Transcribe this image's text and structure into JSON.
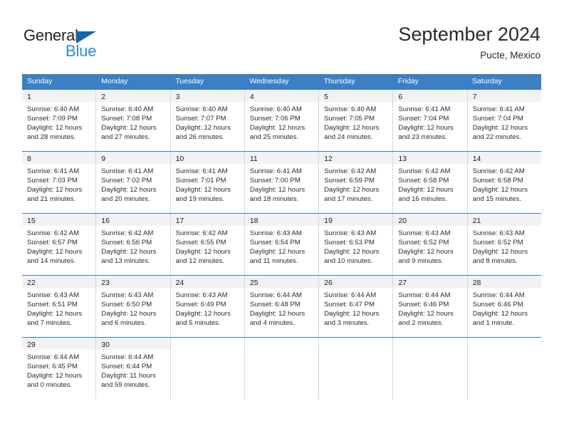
{
  "brand": {
    "name_part1": "General",
    "name_part2": "Blue",
    "triangle_color": "#1565a8",
    "blue_color": "#2e8bd4"
  },
  "header": {
    "title": "September 2024",
    "subtitle": "Pucte, Mexico"
  },
  "theme": {
    "header_blue": "#3b7fc4",
    "daynum_band": "#f2f2f2",
    "cell_border": "#d8d8d8"
  },
  "weekdays": [
    "Sunday",
    "Monday",
    "Tuesday",
    "Wednesday",
    "Thursday",
    "Friday",
    "Saturday"
  ],
  "weeks": [
    [
      {
        "day": "1",
        "sunrise": "Sunrise: 6:40 AM",
        "sunset": "Sunset: 7:09 PM",
        "daylight1": "Daylight: 12 hours",
        "daylight2": "and 28 minutes."
      },
      {
        "day": "2",
        "sunrise": "Sunrise: 6:40 AM",
        "sunset": "Sunset: 7:08 PM",
        "daylight1": "Daylight: 12 hours",
        "daylight2": "and 27 minutes."
      },
      {
        "day": "3",
        "sunrise": "Sunrise: 6:40 AM",
        "sunset": "Sunset: 7:07 PM",
        "daylight1": "Daylight: 12 hours",
        "daylight2": "and 26 minutes."
      },
      {
        "day": "4",
        "sunrise": "Sunrise: 6:40 AM",
        "sunset": "Sunset: 7:06 PM",
        "daylight1": "Daylight: 12 hours",
        "daylight2": "and 25 minutes."
      },
      {
        "day": "5",
        "sunrise": "Sunrise: 6:40 AM",
        "sunset": "Sunset: 7:05 PM",
        "daylight1": "Daylight: 12 hours",
        "daylight2": "and 24 minutes."
      },
      {
        "day": "6",
        "sunrise": "Sunrise: 6:41 AM",
        "sunset": "Sunset: 7:04 PM",
        "daylight1": "Daylight: 12 hours",
        "daylight2": "and 23 minutes."
      },
      {
        "day": "7",
        "sunrise": "Sunrise: 6:41 AM",
        "sunset": "Sunset: 7:04 PM",
        "daylight1": "Daylight: 12 hours",
        "daylight2": "and 22 minutes."
      }
    ],
    [
      {
        "day": "8",
        "sunrise": "Sunrise: 6:41 AM",
        "sunset": "Sunset: 7:03 PM",
        "daylight1": "Daylight: 12 hours",
        "daylight2": "and 21 minutes."
      },
      {
        "day": "9",
        "sunrise": "Sunrise: 6:41 AM",
        "sunset": "Sunset: 7:02 PM",
        "daylight1": "Daylight: 12 hours",
        "daylight2": "and 20 minutes."
      },
      {
        "day": "10",
        "sunrise": "Sunrise: 6:41 AM",
        "sunset": "Sunset: 7:01 PM",
        "daylight1": "Daylight: 12 hours",
        "daylight2": "and 19 minutes."
      },
      {
        "day": "11",
        "sunrise": "Sunrise: 6:41 AM",
        "sunset": "Sunset: 7:00 PM",
        "daylight1": "Daylight: 12 hours",
        "daylight2": "and 18 minutes."
      },
      {
        "day": "12",
        "sunrise": "Sunrise: 6:42 AM",
        "sunset": "Sunset: 6:59 PM",
        "daylight1": "Daylight: 12 hours",
        "daylight2": "and 17 minutes."
      },
      {
        "day": "13",
        "sunrise": "Sunrise: 6:42 AM",
        "sunset": "Sunset: 6:58 PM",
        "daylight1": "Daylight: 12 hours",
        "daylight2": "and 16 minutes."
      },
      {
        "day": "14",
        "sunrise": "Sunrise: 6:42 AM",
        "sunset": "Sunset: 6:58 PM",
        "daylight1": "Daylight: 12 hours",
        "daylight2": "and 15 minutes."
      }
    ],
    [
      {
        "day": "15",
        "sunrise": "Sunrise: 6:42 AM",
        "sunset": "Sunset: 6:57 PM",
        "daylight1": "Daylight: 12 hours",
        "daylight2": "and 14 minutes."
      },
      {
        "day": "16",
        "sunrise": "Sunrise: 6:42 AM",
        "sunset": "Sunset: 6:56 PM",
        "daylight1": "Daylight: 12 hours",
        "daylight2": "and 13 minutes."
      },
      {
        "day": "17",
        "sunrise": "Sunrise: 6:42 AM",
        "sunset": "Sunset: 6:55 PM",
        "daylight1": "Daylight: 12 hours",
        "daylight2": "and 12 minutes."
      },
      {
        "day": "18",
        "sunrise": "Sunrise: 6:43 AM",
        "sunset": "Sunset: 6:54 PM",
        "daylight1": "Daylight: 12 hours",
        "daylight2": "and 11 minutes."
      },
      {
        "day": "19",
        "sunrise": "Sunrise: 6:43 AM",
        "sunset": "Sunset: 6:53 PM",
        "daylight1": "Daylight: 12 hours",
        "daylight2": "and 10 minutes."
      },
      {
        "day": "20",
        "sunrise": "Sunrise: 6:43 AM",
        "sunset": "Sunset: 6:52 PM",
        "daylight1": "Daylight: 12 hours",
        "daylight2": "and 9 minutes."
      },
      {
        "day": "21",
        "sunrise": "Sunrise: 6:43 AM",
        "sunset": "Sunset: 6:52 PM",
        "daylight1": "Daylight: 12 hours",
        "daylight2": "and 8 minutes."
      }
    ],
    [
      {
        "day": "22",
        "sunrise": "Sunrise: 6:43 AM",
        "sunset": "Sunset: 6:51 PM",
        "daylight1": "Daylight: 12 hours",
        "daylight2": "and 7 minutes."
      },
      {
        "day": "23",
        "sunrise": "Sunrise: 6:43 AM",
        "sunset": "Sunset: 6:50 PM",
        "daylight1": "Daylight: 12 hours",
        "daylight2": "and 6 minutes."
      },
      {
        "day": "24",
        "sunrise": "Sunrise: 6:43 AM",
        "sunset": "Sunset: 6:49 PM",
        "daylight1": "Daylight: 12 hours",
        "daylight2": "and 5 minutes."
      },
      {
        "day": "25",
        "sunrise": "Sunrise: 6:44 AM",
        "sunset": "Sunset: 6:48 PM",
        "daylight1": "Daylight: 12 hours",
        "daylight2": "and 4 minutes."
      },
      {
        "day": "26",
        "sunrise": "Sunrise: 6:44 AM",
        "sunset": "Sunset: 6:47 PM",
        "daylight1": "Daylight: 12 hours",
        "daylight2": "and 3 minutes."
      },
      {
        "day": "27",
        "sunrise": "Sunrise: 6:44 AM",
        "sunset": "Sunset: 6:46 PM",
        "daylight1": "Daylight: 12 hours",
        "daylight2": "and 2 minutes."
      },
      {
        "day": "28",
        "sunrise": "Sunrise: 6:44 AM",
        "sunset": "Sunset: 6:46 PM",
        "daylight1": "Daylight: 12 hours",
        "daylight2": "and 1 minute."
      }
    ],
    [
      {
        "day": "29",
        "sunrise": "Sunrise: 6:44 AM",
        "sunset": "Sunset: 6:45 PM",
        "daylight1": "Daylight: 12 hours",
        "daylight2": "and 0 minutes."
      },
      {
        "day": "30",
        "sunrise": "Sunrise: 6:44 AM",
        "sunset": "Sunset: 6:44 PM",
        "daylight1": "Daylight: 11 hours",
        "daylight2": "and 59 minutes."
      },
      {
        "day": "",
        "sunrise": "",
        "sunset": "",
        "daylight1": "",
        "daylight2": ""
      },
      {
        "day": "",
        "sunrise": "",
        "sunset": "",
        "daylight1": "",
        "daylight2": ""
      },
      {
        "day": "",
        "sunrise": "",
        "sunset": "",
        "daylight1": "",
        "daylight2": ""
      },
      {
        "day": "",
        "sunrise": "",
        "sunset": "",
        "daylight1": "",
        "daylight2": ""
      },
      {
        "day": "",
        "sunrise": "",
        "sunset": "",
        "daylight1": "",
        "daylight2": ""
      }
    ]
  ]
}
